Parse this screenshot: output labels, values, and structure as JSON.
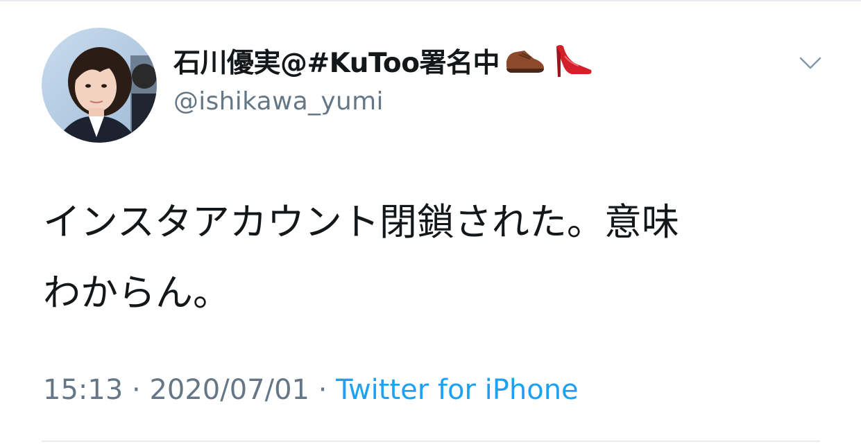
{
  "tweet": {
    "display_name": "石川優実@#KuToo署名中",
    "name_emojis": [
      "mans-shoe-icon",
      "high-heel-icon"
    ],
    "handle": "@ishikawa_yumi",
    "text": "インスタアカウント閉鎖された。意味\nわからん。",
    "time": "15:13",
    "separator": " · ",
    "date": "2020/07/01",
    "source": "Twitter for iPhone",
    "caret_icon": "chevron-down-icon"
  },
  "colors": {
    "text_primary": "#14171a",
    "text_secondary": "#657786",
    "link": "#1da1f2",
    "divider": "#e6ecf0"
  }
}
